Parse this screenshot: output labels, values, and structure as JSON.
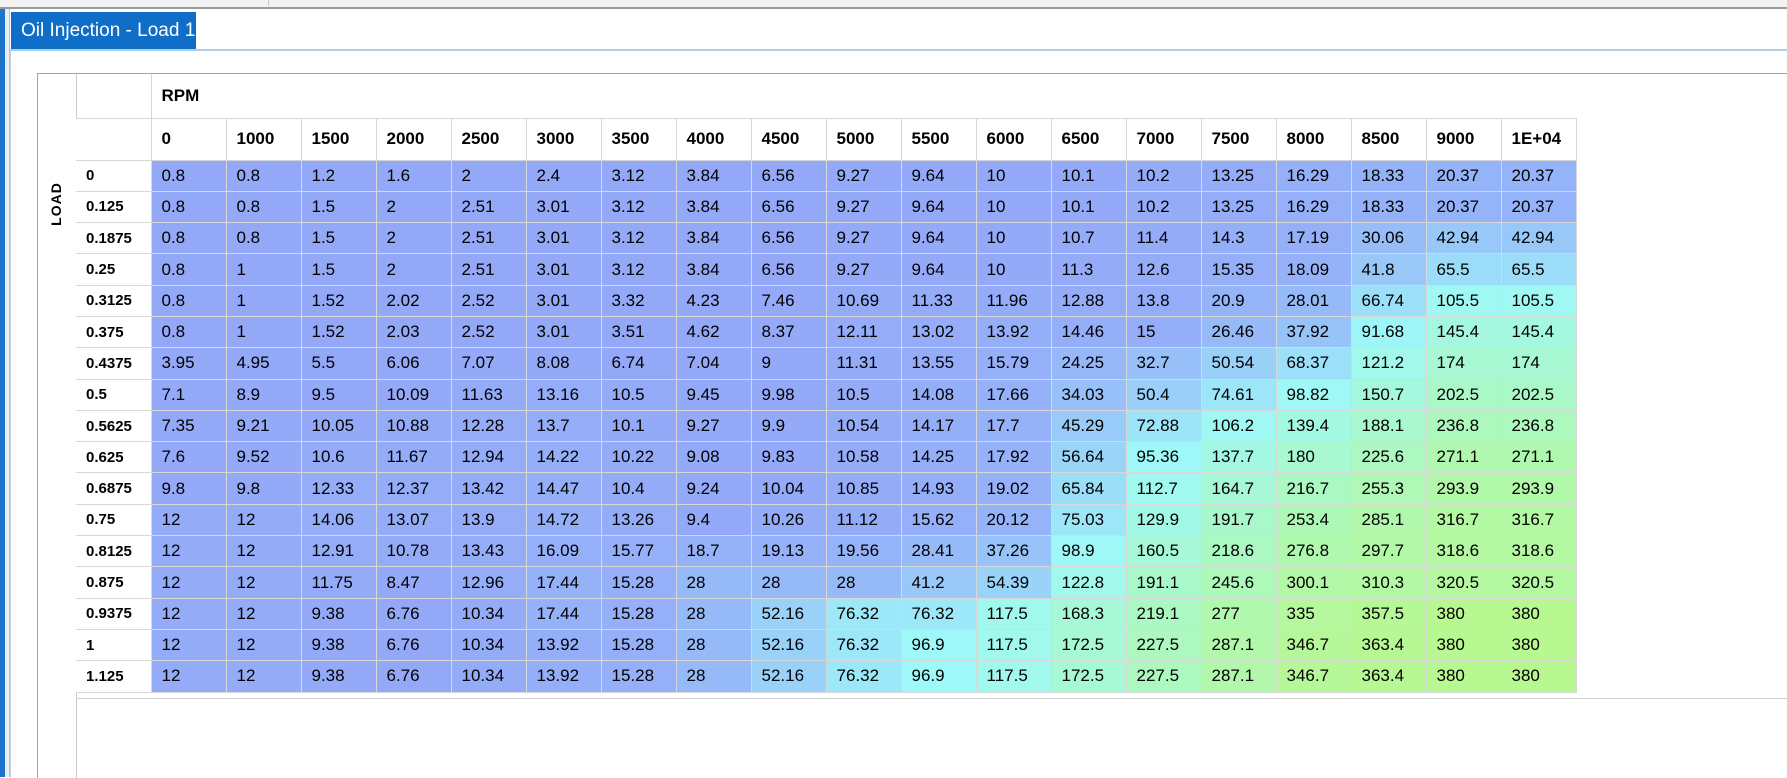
{
  "tab": {
    "title": "Oil Injection - Load 1"
  },
  "table": {
    "rpm_label": "RPM",
    "load_label": "LOAD",
    "columns": [
      "0",
      "1000",
      "1500",
      "2000",
      "2500",
      "3000",
      "3500",
      "4000",
      "4500",
      "5000",
      "5500",
      "6000",
      "6500",
      "7000",
      "7500",
      "8000",
      "8500",
      "9000",
      "1E+04"
    ],
    "rows": [
      {
        "load": "0",
        "values": [
          "0.8",
          "0.8",
          "1.2",
          "1.6",
          "2",
          "2.4",
          "3.12",
          "3.84",
          "6.56",
          "9.27",
          "9.64",
          "10",
          "10.1",
          "10.2",
          "13.25",
          "16.29",
          "18.33",
          "20.37",
          "20.37"
        ]
      },
      {
        "load": "0.125",
        "values": [
          "0.8",
          "0.8",
          "1.5",
          "2",
          "2.51",
          "3.01",
          "3.12",
          "3.84",
          "6.56",
          "9.27",
          "9.64",
          "10",
          "10.1",
          "10.2",
          "13.25",
          "16.29",
          "18.33",
          "20.37",
          "20.37"
        ]
      },
      {
        "load": "0.1875",
        "values": [
          "0.8",
          "0.8",
          "1.5",
          "2",
          "2.51",
          "3.01",
          "3.12",
          "3.84",
          "6.56",
          "9.27",
          "9.64",
          "10",
          "10.7",
          "11.4",
          "14.3",
          "17.19",
          "30.06",
          "42.94",
          "42.94"
        ]
      },
      {
        "load": "0.25",
        "values": [
          "0.8",
          "1",
          "1.5",
          "2",
          "2.51",
          "3.01",
          "3.12",
          "3.84",
          "6.56",
          "9.27",
          "9.64",
          "10",
          "11.3",
          "12.6",
          "15.35",
          "18.09",
          "41.8",
          "65.5",
          "65.5"
        ]
      },
      {
        "load": "0.3125",
        "values": [
          "0.8",
          "1",
          "1.52",
          "2.02",
          "2.52",
          "3.01",
          "3.32",
          "4.23",
          "7.46",
          "10.69",
          "11.33",
          "11.96",
          "12.88",
          "13.8",
          "20.9",
          "28.01",
          "66.74",
          "105.5",
          "105.5"
        ]
      },
      {
        "load": "0.375",
        "values": [
          "0.8",
          "1",
          "1.52",
          "2.03",
          "2.52",
          "3.01",
          "3.51",
          "4.62",
          "8.37",
          "12.11",
          "13.02",
          "13.92",
          "14.46",
          "15",
          "26.46",
          "37.92",
          "91.68",
          "145.4",
          "145.4"
        ]
      },
      {
        "load": "0.4375",
        "values": [
          "3.95",
          "4.95",
          "5.5",
          "6.06",
          "7.07",
          "8.08",
          "6.74",
          "7.04",
          "9",
          "11.31",
          "13.55",
          "15.79",
          "24.25",
          "32.7",
          "50.54",
          "68.37",
          "121.2",
          "174",
          "174"
        ]
      },
      {
        "load": "0.5",
        "values": [
          "7.1",
          "8.9",
          "9.5",
          "10.09",
          "11.63",
          "13.16",
          "10.5",
          "9.45",
          "9.98",
          "10.5",
          "14.08",
          "17.66",
          "34.03",
          "50.4",
          "74.61",
          "98.82",
          "150.7",
          "202.5",
          "202.5"
        ]
      },
      {
        "load": "0.5625",
        "values": [
          "7.35",
          "9.21",
          "10.05",
          "10.88",
          "12.28",
          "13.7",
          "10.1",
          "9.27",
          "9.9",
          "10.54",
          "14.17",
          "17.7",
          "45.29",
          "72.88",
          "106.2",
          "139.4",
          "188.1",
          "236.8",
          "236.8"
        ]
      },
      {
        "load": "0.625",
        "values": [
          "7.6",
          "9.52",
          "10.6",
          "11.67",
          "12.94",
          "14.22",
          "10.22",
          "9.08",
          "9.83",
          "10.58",
          "14.25",
          "17.92",
          "56.64",
          "95.36",
          "137.7",
          "180",
          "225.6",
          "271.1",
          "271.1"
        ]
      },
      {
        "load": "0.6875",
        "values": [
          "9.8",
          "9.8",
          "12.33",
          "12.37",
          "13.42",
          "14.47",
          "10.4",
          "9.24",
          "10.04",
          "10.85",
          "14.93",
          "19.02",
          "65.84",
          "112.7",
          "164.7",
          "216.7",
          "255.3",
          "293.9",
          "293.9"
        ]
      },
      {
        "load": "0.75",
        "values": [
          "12",
          "12",
          "14.06",
          "13.07",
          "13.9",
          "14.72",
          "13.26",
          "9.4",
          "10.26",
          "11.12",
          "15.62",
          "20.12",
          "75.03",
          "129.9",
          "191.7",
          "253.4",
          "285.1",
          "316.7",
          "316.7"
        ]
      },
      {
        "load": "0.8125",
        "values": [
          "12",
          "12",
          "12.91",
          "10.78",
          "13.43",
          "16.09",
          "15.77",
          "18.7",
          "19.13",
          "19.56",
          "28.41",
          "37.26",
          "98.9",
          "160.5",
          "218.6",
          "276.8",
          "297.7",
          "318.6",
          "318.6"
        ]
      },
      {
        "load": "0.875",
        "values": [
          "12",
          "12",
          "11.75",
          "8.47",
          "12.96",
          "17.44",
          "15.28",
          "28",
          "28",
          "28",
          "41.2",
          "54.39",
          "122.8",
          "191.1",
          "245.6",
          "300.1",
          "310.3",
          "320.5",
          "320.5"
        ]
      },
      {
        "load": "0.9375",
        "values": [
          "12",
          "12",
          "9.38",
          "6.76",
          "10.34",
          "17.44",
          "15.28",
          "28",
          "52.16",
          "76.32",
          "76.32",
          "117.5",
          "168.3",
          "219.1",
          "277",
          "335",
          "357.5",
          "380",
          "380"
        ]
      },
      {
        "load": "1",
        "values": [
          "12",
          "12",
          "9.38",
          "6.76",
          "10.34",
          "13.92",
          "15.28",
          "28",
          "52.16",
          "76.32",
          "96.9",
          "117.5",
          "172.5",
          "227.5",
          "287.1",
          "346.7",
          "363.4",
          "380",
          "380"
        ]
      },
      {
        "load": "1.125",
        "values": [
          "12",
          "12",
          "9.38",
          "6.76",
          "10.34",
          "13.92",
          "15.28",
          "28",
          "52.16",
          "76.32",
          "96.9",
          "117.5",
          "172.5",
          "227.5",
          "287.1",
          "346.7",
          "363.4",
          "380",
          "380"
        ]
      }
    ]
  },
  "colors": {
    "tab_bg": "#0f6ec8",
    "accent": "#1e74c8",
    "low": "#94a8f8",
    "mid": "#9ef8f8",
    "high": "#b8f890"
  }
}
